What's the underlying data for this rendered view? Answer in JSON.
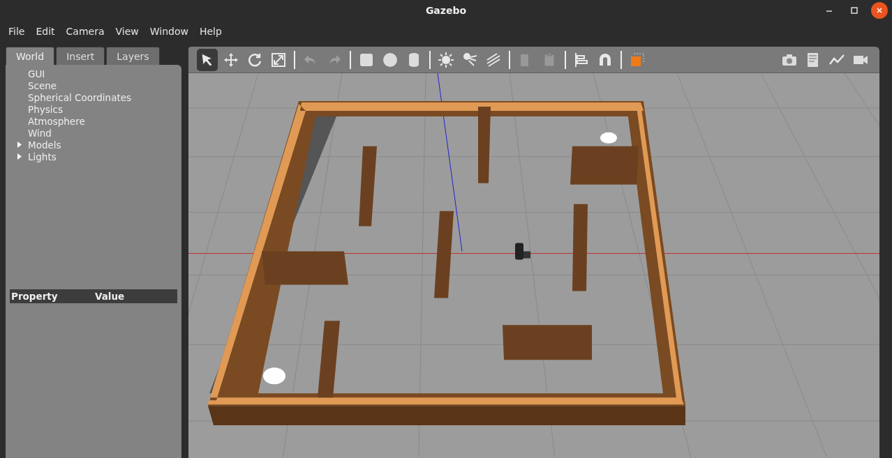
{
  "window": {
    "title": "Gazebo"
  },
  "menu": [
    "File",
    "Edit",
    "Camera",
    "View",
    "Window",
    "Help"
  ],
  "left_panel": {
    "tabs": [
      {
        "label": "World",
        "selected": true
      },
      {
        "label": "Insert",
        "selected": false
      },
      {
        "label": "Layers",
        "selected": false
      }
    ],
    "tree": [
      {
        "label": "GUI",
        "kind": "leaf"
      },
      {
        "label": "Scene",
        "kind": "leaf"
      },
      {
        "label": "Spherical Coordinates",
        "kind": "leaf"
      },
      {
        "label": "Physics",
        "kind": "leaf"
      },
      {
        "label": "Atmosphere",
        "kind": "leaf"
      },
      {
        "label": "Wind",
        "kind": "leaf"
      },
      {
        "label": "Models",
        "kind": "group",
        "expanded": false
      },
      {
        "label": "Lights",
        "kind": "group",
        "expanded": false
      }
    ],
    "property_table": {
      "columns": [
        "Property",
        "Value"
      ]
    }
  },
  "toolbar": {
    "left": [
      {
        "kind": "select",
        "selected": true
      },
      {
        "kind": "translate",
        "selected": false
      },
      {
        "kind": "rotate",
        "selected": false
      },
      {
        "kind": "scale",
        "selected": false
      },
      {
        "kind": "sep"
      },
      {
        "kind": "undo",
        "selected": false
      },
      {
        "kind": "redo",
        "selected": false
      },
      {
        "kind": "sep"
      },
      {
        "kind": "box",
        "selected": false
      },
      {
        "kind": "sphere",
        "selected": false
      },
      {
        "kind": "cylinder",
        "selected": false
      },
      {
        "kind": "sep"
      },
      {
        "kind": "pointlight",
        "selected": false
      },
      {
        "kind": "spotlight",
        "selected": false
      },
      {
        "kind": "dirlight",
        "selected": false
      },
      {
        "kind": "sep"
      },
      {
        "kind": "copy",
        "selected": false
      },
      {
        "kind": "paste",
        "selected": false
      },
      {
        "kind": "sep"
      },
      {
        "kind": "align",
        "selected": false
      },
      {
        "kind": "snap",
        "selected": false
      },
      {
        "kind": "sep"
      },
      {
        "kind": "view",
        "selected": false
      }
    ],
    "right": [
      {
        "kind": "screenshot",
        "selected": false
      },
      {
        "kind": "log",
        "selected": false
      },
      {
        "kind": "plot",
        "selected": false
      },
      {
        "kind": "video",
        "selected": false
      }
    ]
  }
}
